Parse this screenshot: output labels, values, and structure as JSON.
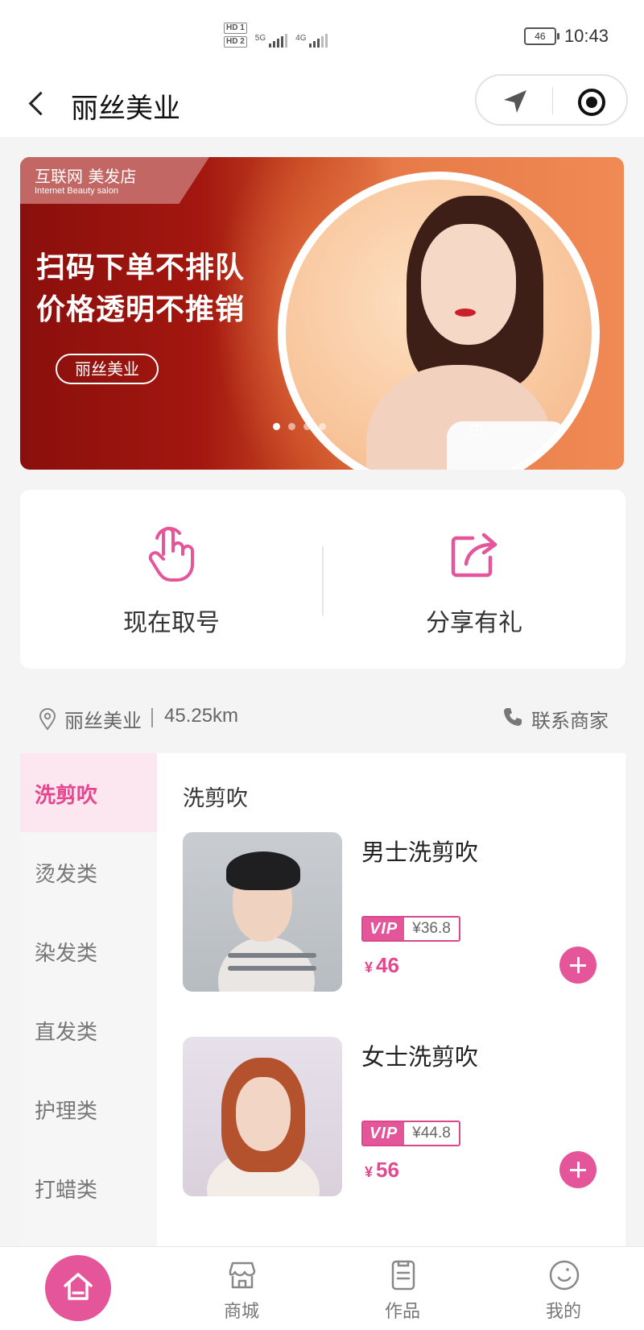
{
  "status_bar": {
    "sim1": "HD 1",
    "sim2": "HD 2",
    "net1": "5G",
    "net2": "4G",
    "battery": "46",
    "time": "10:43"
  },
  "nav": {
    "title": "丽丝美业",
    "icons": [
      "back-icon",
      "location-arrow-icon",
      "record-icon"
    ]
  },
  "banner": {
    "tag_cn": "互联网 美发店",
    "tag_en": "Internet Beauty salon",
    "slogan_line1": "扫码下单不排队",
    "slogan_line2": "价格透明不推销",
    "button": "丽丝美业",
    "slides": 4,
    "active_slide": 1
  },
  "actions": {
    "take_number": "现在取号",
    "share": "分享有礼",
    "accent": "#e5559a"
  },
  "location": {
    "shop": "丽丝美业",
    "distance": "45.25km",
    "contact": "联系商家"
  },
  "categories": {
    "items": [
      {
        "label": "洗剪吹"
      },
      {
        "label": "烫发类"
      },
      {
        "label": "染发类"
      },
      {
        "label": "直发类"
      },
      {
        "label": "护理类"
      },
      {
        "label": "打蜡类"
      }
    ],
    "active": "洗剪吹"
  },
  "products": {
    "section_title": "洗剪吹",
    "items": [
      {
        "name": "男士洗剪吹",
        "vip_badge": "VIP",
        "vip_price": "¥36.8",
        "currency": "¥",
        "price": "46"
      },
      {
        "name": "女士洗剪吹",
        "vip_badge": "VIP",
        "vip_price": "¥44.8",
        "currency": "¥",
        "price": "56"
      }
    ]
  },
  "tabbar": {
    "items": [
      {
        "label": ""
      },
      {
        "label": "商城"
      },
      {
        "label": "作品"
      },
      {
        "label": "我的"
      }
    ]
  },
  "colors": {
    "primary": "#e5559a",
    "active_category_bg": "#fce6ef",
    "banner_dark": "#8a0f0c",
    "banner_light": "#f08a55"
  }
}
